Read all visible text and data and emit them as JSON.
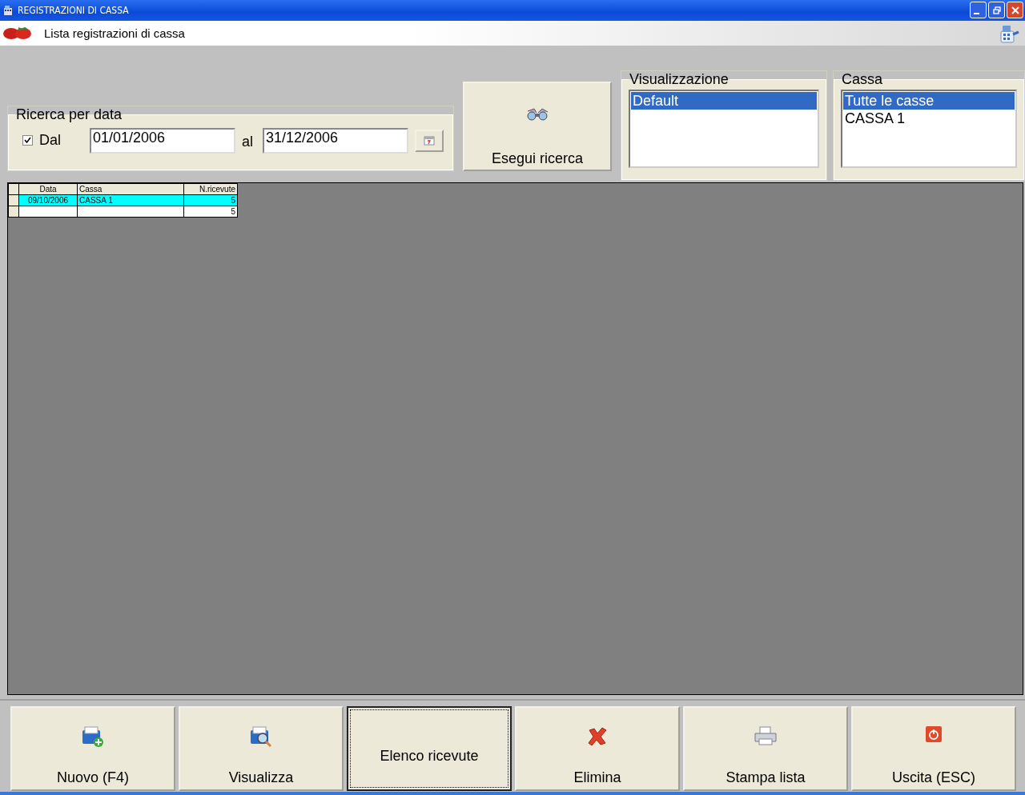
{
  "window": {
    "title": "REGISTRAZIONI DI CASSA"
  },
  "header": {
    "title": "Lista registrazioni di cassa"
  },
  "date_search": {
    "legend": "Ricerca per data",
    "checkbox_label": "Dal",
    "checked": true,
    "from_value": "01/01/2006",
    "to_label": "al",
    "to_value": "31/12/2006"
  },
  "search_button": {
    "label": "Esegui ricerca"
  },
  "view_list": {
    "legend": "Visualizzazione",
    "items": [
      {
        "label": "Default",
        "selected": true
      }
    ]
  },
  "cash_list": {
    "legend": "Cassa",
    "items": [
      {
        "label": "Tutte le casse",
        "selected": true
      },
      {
        "label": "CASSA 1",
        "selected": false
      }
    ]
  },
  "table": {
    "columns": [
      "Data",
      "Cassa",
      "N.ricevute"
    ],
    "rows": [
      {
        "data": "09/10/2006",
        "cassa": "CASSA 1",
        "n_ricevute": "5",
        "selected": true
      },
      {
        "n_ricevute": "5",
        "selected": false
      }
    ]
  },
  "buttons": [
    {
      "label": "Nuovo (F4)",
      "kind": "new",
      "focused": false
    },
    {
      "label": "Visualizza",
      "kind": "view",
      "focused": false
    },
    {
      "label": "Elenco ricevute",
      "kind": "text",
      "focused": true
    },
    {
      "label": "Elimina",
      "kind": "delete",
      "focused": false
    },
    {
      "label": "Stampa lista",
      "kind": "print",
      "focused": false
    },
    {
      "label": "Uscita (ESC)",
      "kind": "exit",
      "focused": false
    }
  ]
}
